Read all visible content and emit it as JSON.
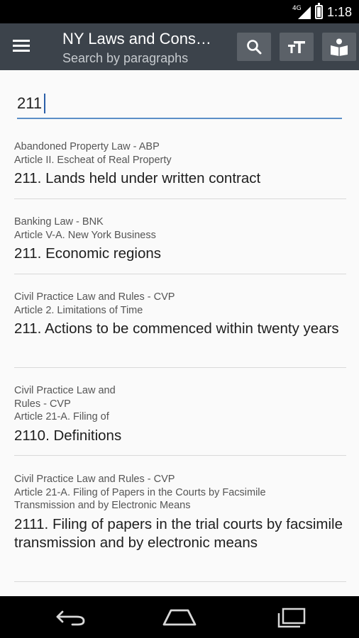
{
  "status_bar": {
    "network": "4G",
    "time": "1:18"
  },
  "app_bar": {
    "title": "NY Laws and Cons…",
    "subtitle": "Search by paragraphs",
    "icons": [
      "menu-icon",
      "search-icon",
      "text-size-icon",
      "book-icon"
    ]
  },
  "search": {
    "value": "211",
    "placeholder": ""
  },
  "results": [
    {
      "law": "Abandoned Property Law - ABP",
      "article": "Article II. Escheat of Real Property",
      "heading": "211. Lands held under written contract"
    },
    {
      "law": "Banking Law - BNK",
      "article": "Article V-A. New York Business",
      "heading": "211. Economic regions"
    },
    {
      "law": "Civil Practice Law and Rules - CVP",
      "article": "Article 2. Limitations of Time",
      "heading": "211. Actions to be commenced within twenty years"
    },
    {
      "law": "Civil Practice Law and\nRules - CVP",
      "article": "Article 21-A. Filing of",
      "heading": "2110. Definitions"
    },
    {
      "law": "Civil Practice Law and Rules - CVP",
      "article": "Article 21-A. Filing of Papers in the Courts by Facsimile Transmission and by Electronic Means",
      "heading": "2111. Filing of papers in the trial courts by facsimile transmission and by electronic means"
    }
  ],
  "nav_bar": {
    "icons": [
      "back-icon",
      "home-icon",
      "recents-icon"
    ]
  }
}
